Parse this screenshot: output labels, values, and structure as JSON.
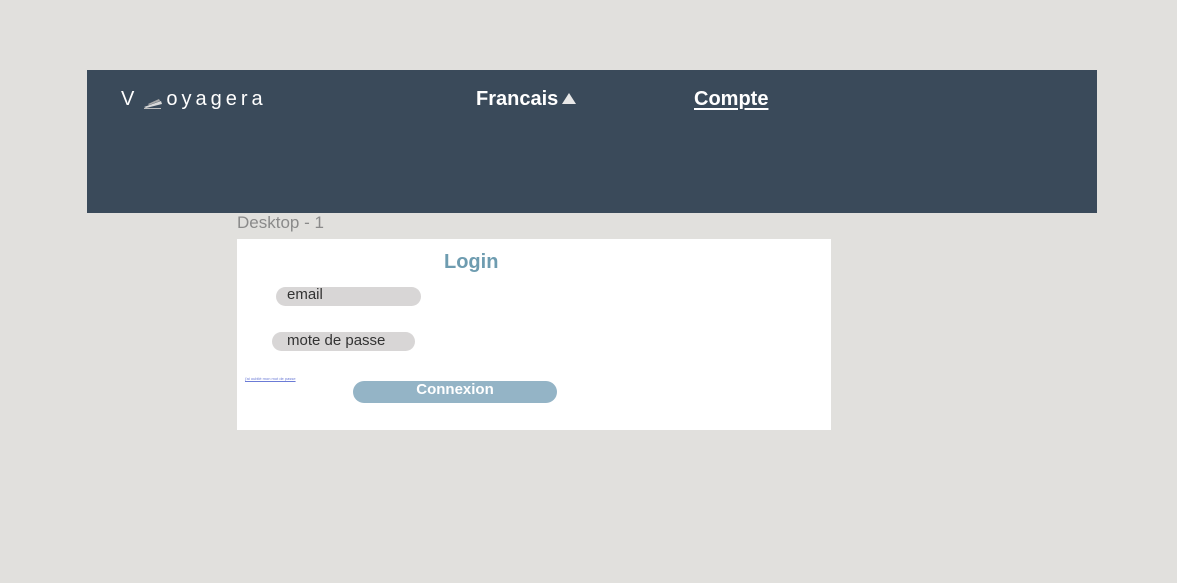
{
  "header": {
    "logo_prefix": "V",
    "logo_icon": "train-icon",
    "logo_suffix": "oyagera",
    "language_label": "Francais",
    "language_icon": "caret-up-icon",
    "account_label": "Compte"
  },
  "canvas": {
    "frame_label": "Desktop - 1"
  },
  "login": {
    "title": "Login",
    "email_placeholder": "email",
    "password_placeholder": "mote de passe",
    "forgot_link": "j'ai oublié mon mot de passe",
    "submit_label": "Connexion"
  },
  "colors": {
    "background": "#e1e0dd",
    "header": "#3a4a5a",
    "accent": "#6e9cb0",
    "button": "#94b4c6",
    "field": "#d8d6d6"
  }
}
